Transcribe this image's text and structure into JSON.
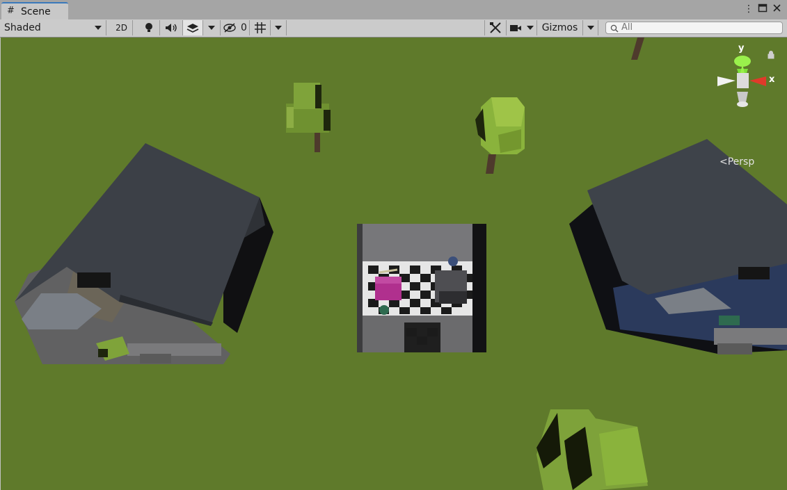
{
  "window": {
    "tab_label": "Scene",
    "menu_icon": "kebab-icon",
    "maximize_icon": "maximize-icon",
    "close_icon": "close-icon"
  },
  "toolbar": {
    "shading_mode": "Shaded",
    "mode_2d": "2D",
    "lighting_icon": "bulb-icon",
    "audio_icon": "speaker-icon",
    "effects_icon": "layers-icon",
    "hidden_count": "0",
    "grid_icon": "grid-icon",
    "tools_icon": "tools-icon",
    "camera_icon": "camera-icon",
    "gizmos_label": "Gizmos",
    "search_placeholder": "All"
  },
  "viewport": {
    "projection_label": "Persp",
    "axis_y": "y",
    "axis_x": "x",
    "colors": {
      "ground": "#5f7a2b",
      "roof": "#3e434a",
      "wall": "#6f6f72",
      "foliage": "#7fa33a",
      "trunk": "#4e3a2c",
      "house_right_wall": "#2b3a5c"
    }
  }
}
